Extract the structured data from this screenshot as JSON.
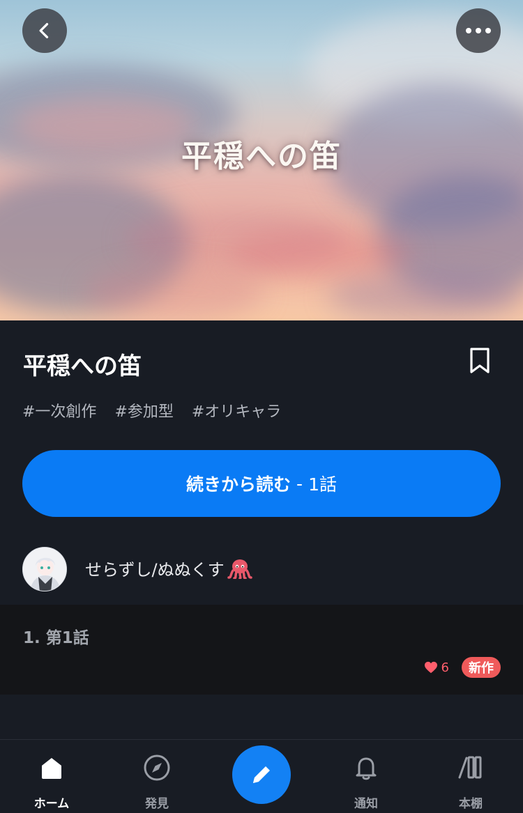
{
  "hero": {
    "title": "平穏への笛",
    "back_icon": "chevron-left-icon",
    "more_icon": "more-horizontal-icon"
  },
  "story": {
    "title": "平穏への笛",
    "bookmark_icon": "bookmark-icon",
    "tags": [
      "#一次創作",
      "#参加型",
      "#オリキャラ"
    ],
    "continue_button": {
      "label": "続きから読む",
      "separator": "-",
      "episode": "1話"
    },
    "author": {
      "name": "せらずし/ぬぬくす",
      "emoji": "🐙"
    }
  },
  "episodes": [
    {
      "title": "1. 第1話",
      "likes": "6",
      "badge": "新作"
    }
  ],
  "nav": {
    "items": [
      {
        "label": "ホーム",
        "icon": "home-icon",
        "active": true
      },
      {
        "label": "発見",
        "icon": "compass-icon",
        "active": false
      },
      {
        "label": "",
        "icon": "pencil-icon",
        "active": false
      },
      {
        "label": "通知",
        "icon": "bell-icon",
        "active": false
      },
      {
        "label": "本棚",
        "icon": "bookshelf-icon",
        "active": false
      }
    ]
  },
  "colors": {
    "accent": "#0a7bf5",
    "background": "#181c24",
    "episode_bg": "#141518",
    "like": "#ff5e6c",
    "new_badge": "#ef5a5a"
  }
}
